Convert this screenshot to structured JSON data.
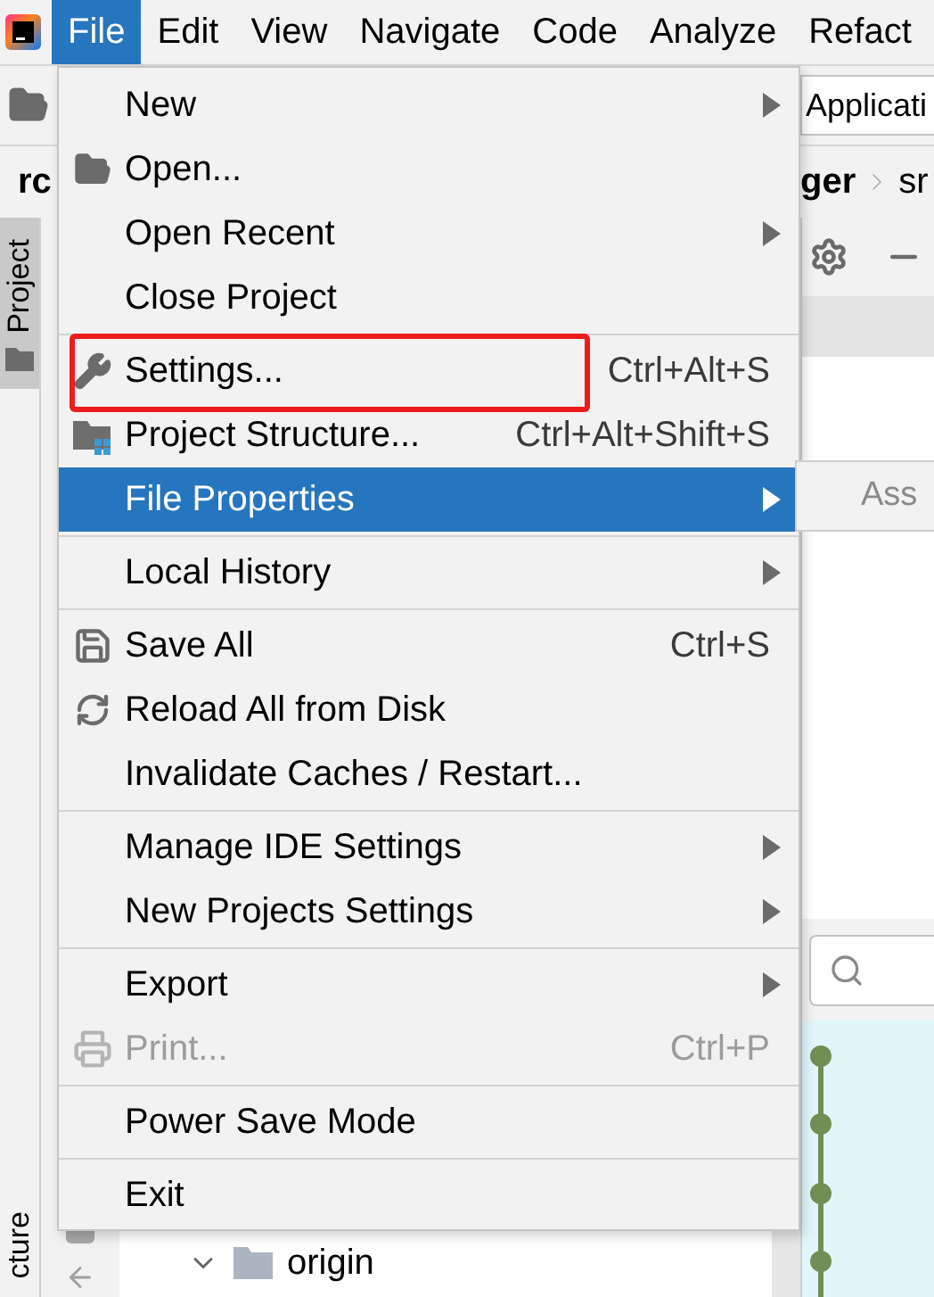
{
  "menu_bar": {
    "items": [
      {
        "label": "File",
        "selected": true
      },
      {
        "label": "Edit",
        "selected": false
      },
      {
        "label": "View",
        "selected": false
      },
      {
        "label": "Navigate",
        "selected": false
      },
      {
        "label": "Code",
        "selected": false
      },
      {
        "label": "Analyze",
        "selected": false
      },
      {
        "label": "Refact",
        "selected": false
      }
    ]
  },
  "toolbar": {
    "run_config": "Applicati"
  },
  "breadcrumb": {
    "left": "rc",
    "items": [
      "ger",
      "sr"
    ]
  },
  "tool_strip": {
    "tabs": [
      {
        "label": "Project",
        "selected": true
      },
      {
        "label": "cture",
        "selected": false
      }
    ]
  },
  "file_menu": {
    "items": [
      {
        "kind": "item",
        "label": "New",
        "submenu": true,
        "selected": false,
        "disabled": false,
        "highlighted": false
      },
      {
        "kind": "item",
        "label": "Open...",
        "submenu": false,
        "selected": false,
        "disabled": false,
        "highlighted": false
      },
      {
        "kind": "item",
        "label": "Open Recent",
        "submenu": true,
        "selected": false,
        "disabled": false,
        "highlighted": false
      },
      {
        "kind": "item",
        "label": "Close Project",
        "submenu": false,
        "selected": false,
        "disabled": false,
        "highlighted": false
      },
      {
        "kind": "separator"
      },
      {
        "kind": "item",
        "label": "Settings...",
        "shortcut": "Ctrl+Alt+S",
        "submenu": false,
        "selected": false,
        "disabled": false,
        "highlighted": true
      },
      {
        "kind": "item",
        "label": "Project Structure...",
        "shortcut": "Ctrl+Alt+Shift+S",
        "submenu": false,
        "selected": false,
        "disabled": false,
        "highlighted": false
      },
      {
        "kind": "item",
        "label": "File Properties",
        "submenu": true,
        "selected": true,
        "disabled": false,
        "highlighted": false
      },
      {
        "kind": "separator"
      },
      {
        "kind": "item",
        "label": "Local History",
        "submenu": true,
        "selected": false,
        "disabled": false,
        "highlighted": false
      },
      {
        "kind": "separator"
      },
      {
        "kind": "item",
        "label": "Save All",
        "shortcut": "Ctrl+S",
        "submenu": false,
        "selected": false,
        "disabled": false,
        "highlighted": false
      },
      {
        "kind": "item",
        "label": "Reload All from Disk",
        "submenu": false,
        "selected": false,
        "disabled": false,
        "highlighted": false
      },
      {
        "kind": "item",
        "label": "Invalidate Caches / Restart...",
        "submenu": false,
        "selected": false,
        "disabled": false,
        "highlighted": false
      },
      {
        "kind": "separator"
      },
      {
        "kind": "item",
        "label": "Manage IDE Settings",
        "submenu": true,
        "selected": false,
        "disabled": false,
        "highlighted": false
      },
      {
        "kind": "item",
        "label": "New Projects Settings",
        "submenu": true,
        "selected": false,
        "disabled": false,
        "highlighted": false
      },
      {
        "kind": "separator"
      },
      {
        "kind": "item",
        "label": "Export",
        "submenu": true,
        "selected": false,
        "disabled": false,
        "highlighted": false
      },
      {
        "kind": "item",
        "label": "Print...",
        "shortcut": "Ctrl+P",
        "submenu": false,
        "selected": false,
        "disabled": true,
        "highlighted": false
      },
      {
        "kind": "separator"
      },
      {
        "kind": "item",
        "label": "Power Save Mode",
        "submenu": false,
        "selected": false,
        "disabled": false,
        "highlighted": false
      },
      {
        "kind": "separator"
      },
      {
        "kind": "item",
        "label": "Exit",
        "submenu": false,
        "selected": false,
        "disabled": false,
        "highlighted": false
      }
    ]
  },
  "submenu": {
    "items": [
      {
        "label": "Ass"
      }
    ]
  },
  "tree": {
    "items": [
      {
        "label": "origin",
        "expanded": true
      }
    ]
  }
}
